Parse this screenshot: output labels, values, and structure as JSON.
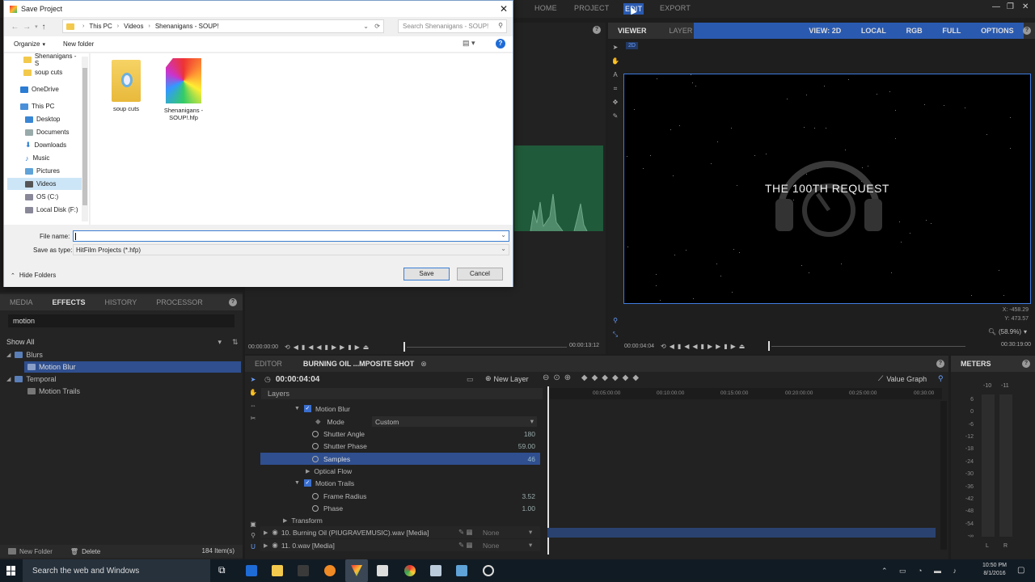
{
  "top_tabs": [
    "HOME",
    "PROJECT",
    "EDIT",
    "EXPORT"
  ],
  "window_controls": [
    "—",
    "❐",
    "✕"
  ],
  "viewer": {
    "tabs": [
      "VIEWER",
      "LAYER"
    ],
    "options": [
      "VIEW: 2D",
      "LOCAL",
      "RGB",
      "FULL",
      "OPTIONS"
    ],
    "mode_badge": "2D",
    "overlay_text": "THE 100TH REQUEST",
    "coord_x": "X:  -458.29",
    "coord_y": "Y:   473.57",
    "zoom": "(58.9%)",
    "time_start": "00:00:04:04",
    "time_end": "00:30:19:00"
  },
  "trimmer": {
    "time_start": "00:00:00:00",
    "time_end": "00:00:13:12"
  },
  "effects_panel": {
    "tabs": [
      "MEDIA",
      "EFFECTS",
      "HISTORY",
      "PROCESSOR"
    ],
    "search_value": "motion",
    "filter": "Show All",
    "tree": [
      {
        "label": "Blurs",
        "level": 0
      },
      {
        "label": "Motion Blur",
        "level": 1,
        "selected": true
      },
      {
        "label": "Temporal",
        "level": 0
      },
      {
        "label": "Motion Trails",
        "level": 1
      }
    ],
    "footer": {
      "new_folder": "New Folder",
      "delete": "Delete",
      "count": "184 Item(s)"
    }
  },
  "editor": {
    "tabs": [
      "EDITOR",
      "BURNING OIL ...MPOSITE SHOT"
    ],
    "timecode": "00:00:04:04",
    "new_layer": "New Layer",
    "value_graph": "Value Graph",
    "layers_label": "Layers",
    "ruler": [
      "00:05:00:00",
      "00:10:00:00",
      "00:15:00:00",
      "00:20:00:00",
      "00:25:00:00",
      "00:30:00"
    ],
    "rows": {
      "motion_blur": "Motion Blur",
      "mode": {
        "label": "Mode",
        "value": "Custom"
      },
      "shutter_angle": {
        "label": "Shutter Angle",
        "value": "180"
      },
      "shutter_phase": {
        "label": "Shutter Phase",
        "value": "59.00"
      },
      "samples": {
        "label": "Samples",
        "value": "46"
      },
      "optical_flow": "Optical Flow",
      "motion_trails": "Motion Trails",
      "frame_radius": {
        "label": "Frame Radius",
        "value": "3.52"
      },
      "phase": {
        "label": "Phase",
        "value": "1.00"
      },
      "transform": "Transform",
      "layer10": {
        "label": "10. Burning Oil (PIUGRAVEMUSIC).wav [Media]",
        "blend": "None"
      },
      "layer11": {
        "label": "11. 0.wav [Media]",
        "blend": "None"
      }
    }
  },
  "meters": {
    "title": "METERS",
    "top": [
      "-10",
      "-11"
    ],
    "scale": [
      "6",
      "0",
      "-6",
      "-12",
      "-18",
      "-24",
      "-30",
      "-36",
      "-42",
      "-48",
      "-54",
      "-∞"
    ],
    "lr": [
      "L",
      "R"
    ]
  },
  "dialog": {
    "title": "Save Project",
    "path": [
      "This PC",
      "Videos",
      "Shenanigans - SOUP!"
    ],
    "search_placeholder": "Search Shenanigans - SOUP!",
    "organize": "Organize",
    "new_folder": "New folder",
    "nav": [
      "Shenanigans - S",
      "soup cuts",
      "OneDrive",
      "This PC",
      "Desktop",
      "Documents",
      "Downloads",
      "Music",
      "Pictures",
      "Videos",
      "OS (C:)",
      "Local Disk (F:)"
    ],
    "files": [
      {
        "name": "soup cuts"
      },
      {
        "name": "Shenanigans - SOUP!.hfp"
      }
    ],
    "file_name_label": "File name:",
    "file_name_value": "",
    "save_type_label": "Save as type:",
    "save_type_value": "HitFilm Projects (*.hfp)",
    "hide_folders": "Hide Folders",
    "save": "Save",
    "cancel": "Cancel"
  },
  "taskbar": {
    "search": "Search the web and Windows",
    "time": "10:50 PM",
    "date": "8/1/2016"
  }
}
